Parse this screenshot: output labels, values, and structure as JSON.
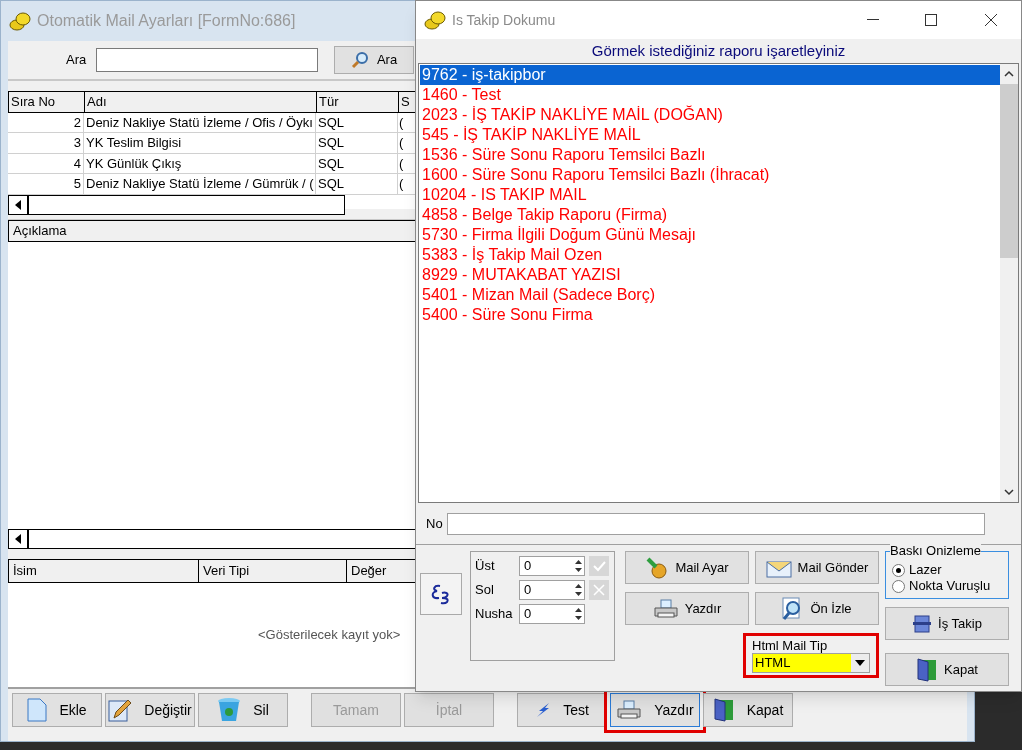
{
  "main_window": {
    "title": "Otomatik Mail Ayarları [FormNo:686]",
    "search": {
      "label": "Ara",
      "button": "Ara"
    },
    "grid": {
      "columns": [
        "Sıra No",
        "Adı",
        "Tür",
        "S"
      ],
      "rows": [
        {
          "cells": [
            "2",
            "Deniz Nakliye Statü İzleme / Ofis / Öykı",
            "SQL",
            "("
          ]
        },
        {
          "cells": [
            "3",
            "YK Teslim Bilgisi",
            "SQL",
            "("
          ]
        },
        {
          "cells": [
            "4",
            "YK Günlük Çıkış",
            "SQL",
            "("
          ]
        },
        {
          "cells": [
            "5",
            "Deniz Nakliye Statü İzleme / Gümrük / (",
            "SQL",
            "("
          ]
        }
      ]
    },
    "description": {
      "column": "Açıklama"
    },
    "params": {
      "columns": [
        "İsim",
        "Veri Tipi",
        "Değer"
      ],
      "empty_text": "<Gösterilecek kayıt yok>"
    },
    "buttons": [
      {
        "kind": "new",
        "label": "Ekle",
        "disabled": false,
        "highlighted": false
      },
      {
        "kind": "edit",
        "label": "Değiştir",
        "disabled": false,
        "highlighted": false
      },
      {
        "kind": "delete",
        "label": "Sil",
        "disabled": false,
        "highlighted": false
      },
      {
        "kind": "plain",
        "label": "Tamam",
        "disabled": true,
        "highlighted": false
      },
      {
        "kind": "plain",
        "label": "İptal",
        "disabled": true,
        "highlighted": false
      },
      {
        "kind": "test",
        "label": "Test",
        "disabled": false,
        "highlighted": false
      },
      {
        "kind": "print",
        "label": "Yazdır",
        "disabled": false,
        "highlighted": true
      },
      {
        "kind": "exit",
        "label": "Kapat",
        "disabled": false,
        "highlighted": false
      }
    ]
  },
  "dialog": {
    "title": "Is Takip Dokumu",
    "heading": "Görmek istediğiniz raporu işaretleyiniz",
    "reports": [
      {
        "label": "9762 - iş-takipbor",
        "selected": true
      },
      {
        "label": "1460 - Test",
        "selected": false
      },
      {
        "label": "2023 - İŞ TAKİP NAKLİYE MAİL (DOĞAN)",
        "selected": false
      },
      {
        "label": "545 - İŞ TAKİP NAKLİYE MAİL",
        "selected": false
      },
      {
        "label": "1536 - Süre Sonu Raporu Temsilci Bazlı",
        "selected": false
      },
      {
        "label": "1600 - Süre Sonu Raporu Temsilci Bazlı (İhracat)",
        "selected": false
      },
      {
        "label": "10204 - IS TAKIP MAIL",
        "selected": false
      },
      {
        "label": "4858 - Belge Takip Raporu (Firma)",
        "selected": false
      },
      {
        "label": "5730 - Firma İlgili Doğum Günü Mesajı",
        "selected": false
      },
      {
        "label": "5383 - İş Takip Mail Ozen",
        "selected": false
      },
      {
        "label": "8929 - MUTAKABAT YAZISI",
        "selected": false
      },
      {
        "label": "5401 - Mizan Mail (Sadece Borç)",
        "selected": false
      },
      {
        "label": "5400 - Süre Sonu Firma",
        "selected": false
      }
    ],
    "no_label": "No",
    "spinners": [
      {
        "label": "Üst",
        "value": "0"
      },
      {
        "label": "Sol",
        "value": "0"
      },
      {
        "label": "Nusha",
        "value": "0"
      }
    ],
    "buttons": [
      {
        "kind": "mail_settings",
        "label": "Mail Ayar"
      },
      {
        "kind": "mail_send",
        "label": "Mail Gönder"
      },
      {
        "kind": "print",
        "label": "Yazdır"
      },
      {
        "kind": "preview",
        "label": "Ön İzle"
      },
      {
        "kind": "track",
        "label": "İş Takip"
      },
      {
        "kind": "exit",
        "label": "Kapat"
      }
    ],
    "print_preview": {
      "title": "Baskı Onizleme",
      "options": [
        {
          "label": "Lazer",
          "selected": true
        },
        {
          "label": "Nokta Vuruşlu",
          "selected": false
        }
      ]
    },
    "html_mail_type": {
      "label": "Html Mail Tip",
      "value": "HTML",
      "highlighted": true
    }
  }
}
